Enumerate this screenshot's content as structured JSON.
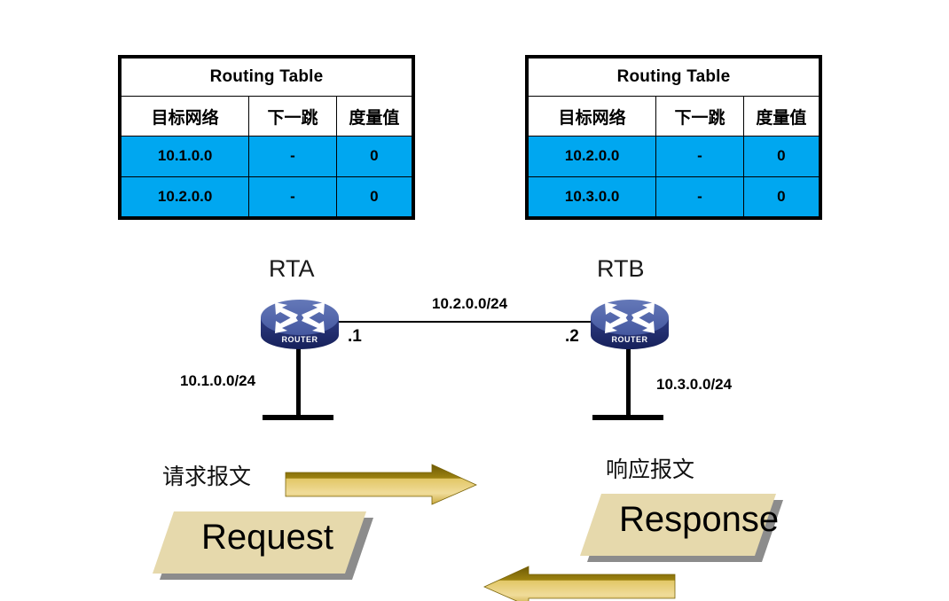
{
  "tables": [
    {
      "id": "rta-routing-table",
      "title": "Routing Table",
      "headers": [
        "目标网络",
        "下一跳",
        "度量值"
      ],
      "rows": [
        [
          "10.1.0.0",
          "-",
          "0"
        ],
        [
          "10.2.0.0",
          "-",
          "0"
        ]
      ]
    },
    {
      "id": "rtb-routing-table",
      "title": "Routing Table",
      "headers": [
        "目标网络",
        "下一跳",
        "度量值"
      ],
      "rows": [
        [
          "10.2.0.0",
          "-",
          "0"
        ],
        [
          "10.3.0.0",
          "-",
          "0"
        ]
      ]
    }
  ],
  "topology": {
    "router_a": {
      "name": "RTA",
      "icon": "router-icon",
      "icon_caption": "ROUTER",
      "interface_label": ".1",
      "lan_label": "10.1.0.0/24"
    },
    "router_b": {
      "name": "RTB",
      "icon": "router-icon",
      "icon_caption": "ROUTER",
      "interface_label": ".2",
      "lan_label": "10.3.0.0/24"
    },
    "link_label": "10.2.0.0/24"
  },
  "messages": {
    "request": {
      "caption": "请求报文",
      "packet_text": "Request",
      "arrow_direction": "right"
    },
    "response": {
      "caption": "响应报文",
      "packet_text": "Response",
      "arrow_direction": "left"
    }
  },
  "colors": {
    "table_row_blue": "#00A7F0",
    "router_blue": "#4A5FA5",
    "router_blue_dark": "#1F2A6B",
    "packet_beige": "#E6D9AC",
    "packet_shadow": "#8C8C8C",
    "arrow_gold_light": "#E8CE78",
    "arrow_gold_dark": "#8C7410",
    "border_black": "#000000"
  }
}
